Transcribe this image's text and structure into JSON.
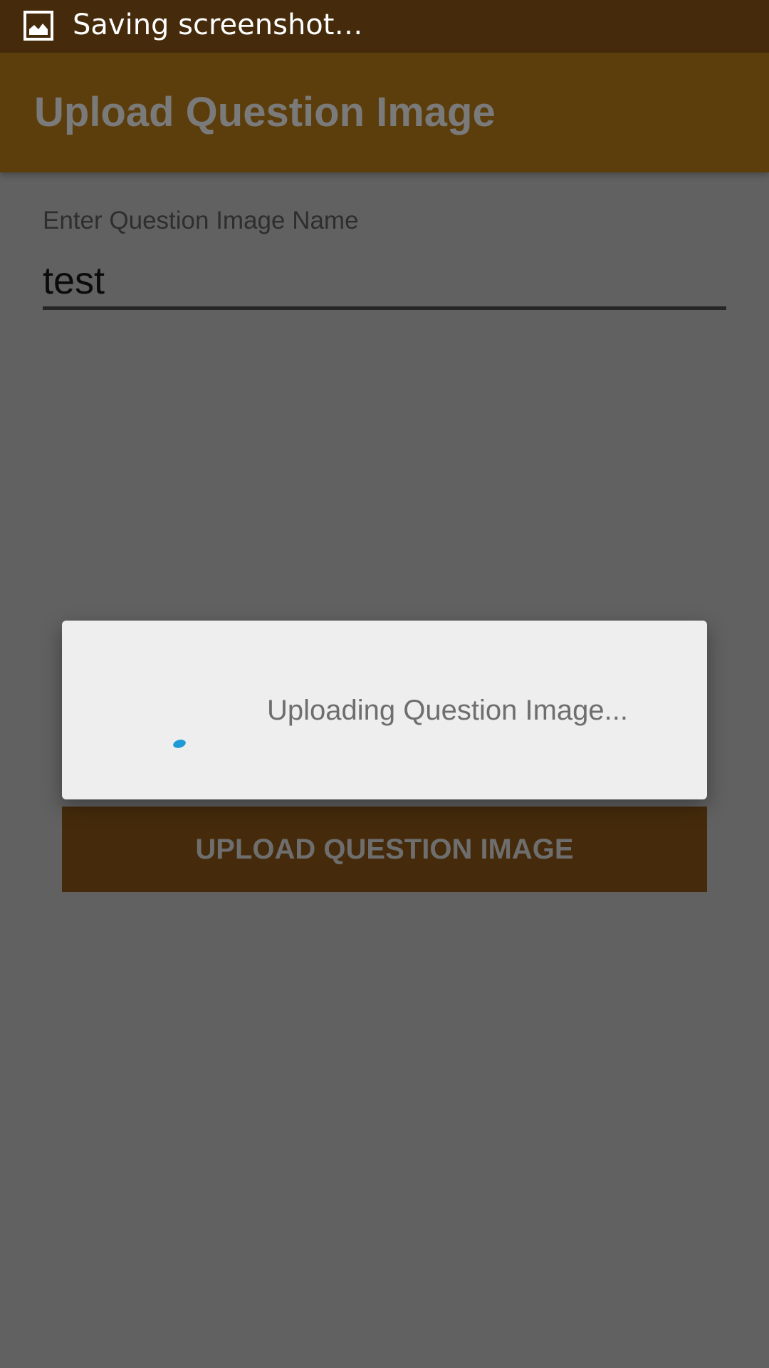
{
  "status_bar": {
    "notification_text": "Saving screenshot…",
    "icon": "image-icon"
  },
  "app_bar": {
    "title": "Upload Question Image"
  },
  "form": {
    "field_label": "Enter Question Image Name",
    "field_value": "test"
  },
  "dialog": {
    "message": "Uploading Question Image...",
    "spinner_icon": "progress-spinner-icon",
    "spinner_color": "#1e9bd7"
  },
  "upload_button": {
    "label": "UPLOAD QUESTION IMAGE"
  },
  "colors": {
    "status_bar": "#452b0b",
    "app_bar": "#5c3e0d",
    "scrim_background": "#616161",
    "button_background": "#452b0b",
    "dialog_background": "#eeeeee"
  }
}
